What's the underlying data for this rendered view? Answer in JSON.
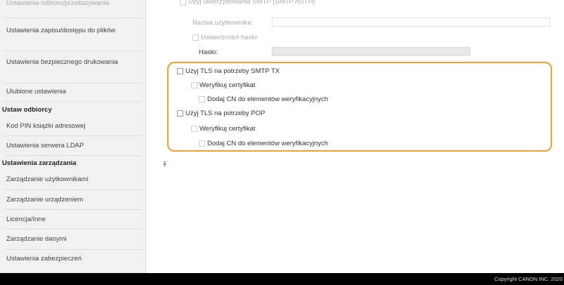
{
  "sidebar": {
    "top_partial": "Ustawienia odbioru/przekazywania",
    "items_a": [
      "Ustawienia zapisu/dostępu do plików",
      "Ustawienia bezpiecznego drukowania",
      "Ulubione ustawienia"
    ],
    "heading_receive": "Ustaw odbiorcy",
    "items_b": [
      "Kod PIN książki adresowej",
      "Ustawienia serwera LDAP"
    ],
    "heading_mgmt": "Ustawienia zarządzania",
    "items_c": [
      "Zarządzanie użytkownikami",
      "Zarządzanie urządzeniem",
      "Licencja/Inne",
      "Zarządzanie danymi",
      "Ustawienia zabezpieczeń"
    ]
  },
  "form": {
    "partial_top": "Użyj uwierzytelniania SMTP (SMTP AUTH)",
    "username_label": "Nazwa użytkownika:",
    "set_password_label": "Ustaw/zmień hasło",
    "password_label": "Hasło:",
    "tls_smtp_label": "Użyj TLS na potrzeby SMTP TX",
    "verify_cert_label": "Weryfikuj certyfikat",
    "add_cn_label": "Dodaj CN do elementów weryfikacyjnych",
    "tls_pop_label": "Użyj TLS na potrzeby POP",
    "verify_cert_label_2": "Weryfikuj certyfikat",
    "add_cn_label_2": "Dodaj CN do elementów weryfikacyjnych"
  },
  "scroll_top_icon": "⩱",
  "footer": {
    "copyright": "Copyright CANON INC. 2020"
  },
  "colors": {
    "highlight": "#f0a030",
    "footer": "#000000",
    "sidebar_bg": "#f1f1f1"
  }
}
